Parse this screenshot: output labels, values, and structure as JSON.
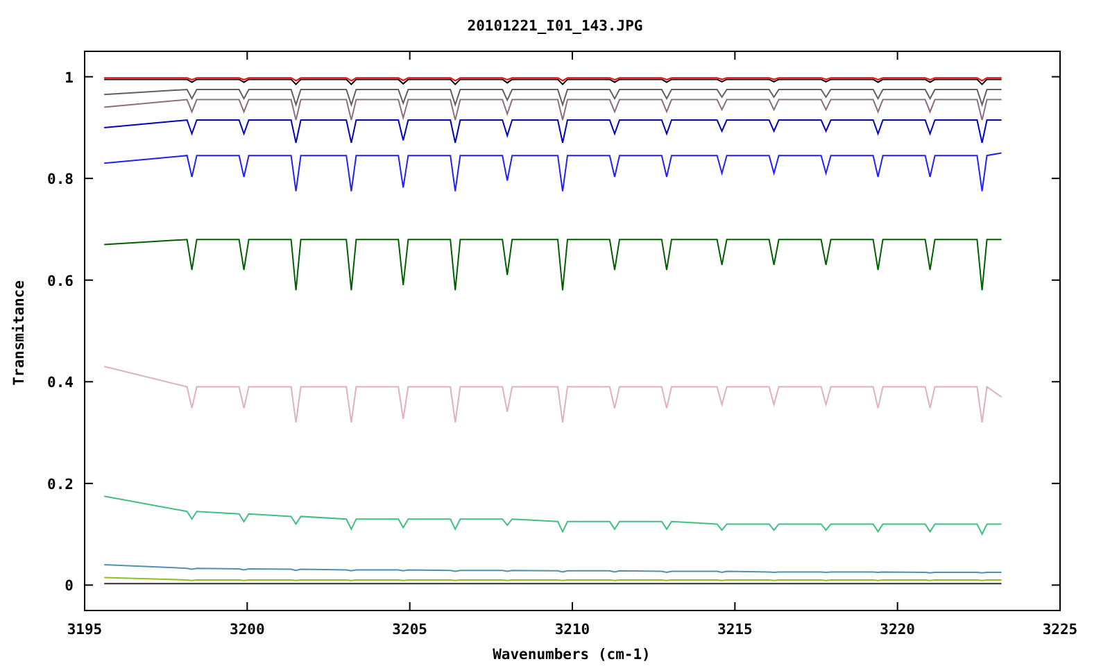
{
  "chart_data": {
    "type": "line",
    "title": "20101221_I01_143.JPG",
    "xlabel": "Wavenumbers (cm-1)",
    "ylabel": "Transmitance",
    "x": [
      3195.6,
      3198.15,
      3198.3,
      3198.45,
      3199.75,
      3199.9,
      3200.05,
      3201.35,
      3201.5,
      3201.65,
      3203.05,
      3203.2,
      3203.35,
      3204.65,
      3204.8,
      3204.95,
      3206.25,
      3206.4,
      3206.55,
      3207.85,
      3208.0,
      3208.15,
      3209.55,
      3209.7,
      3209.85,
      3211.15,
      3211.3,
      3211.45,
      3212.75,
      3212.9,
      3213.05,
      3214.45,
      3214.6,
      3214.75,
      3216.05,
      3216.2,
      3216.35,
      3217.65,
      3217.8,
      3217.95,
      3219.25,
      3219.4,
      3219.55,
      3220.85,
      3221.0,
      3221.15,
      3222.45,
      3222.6,
      3222.75,
      3223.2
    ],
    "xlim": [
      3195,
      3225
    ],
    "ylim": [
      -0.05,
      1.05
    ],
    "xticks": [
      3195,
      3200,
      3205,
      3210,
      3215,
      3220,
      3225
    ],
    "yticks": [
      0,
      0.2,
      0.4,
      0.6,
      0.8,
      1
    ],
    "series": [
      {
        "color": "#000000",
        "values": [
          0.995,
          0.995,
          0.989,
          0.995,
          0.995,
          0.989,
          0.995,
          0.995,
          0.985,
          0.995,
          0.995,
          0.985,
          0.995,
          0.995,
          0.986,
          0.995,
          0.995,
          0.985,
          0.995,
          0.995,
          0.988,
          0.995,
          0.995,
          0.985,
          0.995,
          0.995,
          0.989,
          0.995,
          0.995,
          0.989,
          0.995,
          0.995,
          0.99,
          0.995,
          0.995,
          0.99,
          0.995,
          0.995,
          0.99,
          0.995,
          0.995,
          0.989,
          0.995,
          0.995,
          0.989,
          0.995,
          0.995,
          0.985,
          0.995,
          0.995
        ]
      },
      {
        "color": "#ff0000",
        "values": [
          0.998,
          0.998,
          0.994,
          0.998,
          0.998,
          0.994,
          0.998,
          0.998,
          0.992,
          0.998,
          0.998,
          0.992,
          0.998,
          0.998,
          0.993,
          0.998,
          0.998,
          0.992,
          0.998,
          0.998,
          0.994,
          0.998,
          0.998,
          0.992,
          0.998,
          0.998,
          0.994,
          0.998,
          0.998,
          0.994,
          0.998,
          0.998,
          0.995,
          0.998,
          0.998,
          0.995,
          0.998,
          0.998,
          0.995,
          0.998,
          0.998,
          0.994,
          0.998,
          0.998,
          0.994,
          0.998,
          0.998,
          0.992,
          0.998,
          0.998
        ]
      },
      {
        "color": "#606060",
        "values": [
          0.965,
          0.975,
          0.957,
          0.975,
          0.975,
          0.957,
          0.975,
          0.975,
          0.945,
          0.975,
          0.975,
          0.945,
          0.975,
          0.975,
          0.948,
          0.975,
          0.975,
          0.945,
          0.975,
          0.975,
          0.954,
          0.975,
          0.975,
          0.945,
          0.975,
          0.975,
          0.957,
          0.975,
          0.975,
          0.957,
          0.975,
          0.975,
          0.96,
          0.975,
          0.975,
          0.96,
          0.975,
          0.975,
          0.96,
          0.975,
          0.975,
          0.957,
          0.975,
          0.975,
          0.957,
          0.975,
          0.975,
          0.945,
          0.975,
          0.975
        ]
      },
      {
        "color": "#8a7080",
        "values": [
          0.94,
          0.955,
          0.931,
          0.955,
          0.955,
          0.931,
          0.955,
          0.955,
          0.915,
          0.955,
          0.955,
          0.915,
          0.955,
          0.955,
          0.919,
          0.955,
          0.955,
          0.915,
          0.955,
          0.955,
          0.927,
          0.955,
          0.955,
          0.915,
          0.955,
          0.955,
          0.931,
          0.955,
          0.955,
          0.931,
          0.955,
          0.955,
          0.935,
          0.955,
          0.955,
          0.935,
          0.955,
          0.955,
          0.935,
          0.955,
          0.955,
          0.931,
          0.955,
          0.955,
          0.931,
          0.955,
          0.955,
          0.915,
          0.955,
          0.955
        ]
      },
      {
        "color": "#0000c0",
        "values": [
          0.9,
          0.915,
          0.888,
          0.915,
          0.915,
          0.888,
          0.915,
          0.915,
          0.87,
          0.915,
          0.915,
          0.87,
          0.915,
          0.915,
          0.875,
          0.915,
          0.915,
          0.87,
          0.915,
          0.915,
          0.884,
          0.915,
          0.915,
          0.87,
          0.915,
          0.915,
          0.888,
          0.915,
          0.915,
          0.888,
          0.915,
          0.915,
          0.893,
          0.915,
          0.915,
          0.893,
          0.915,
          0.915,
          0.893,
          0.915,
          0.915,
          0.888,
          0.915,
          0.915,
          0.888,
          0.915,
          0.915,
          0.87,
          0.915,
          0.915
        ]
      },
      {
        "color": "#2020ff",
        "values": [
          0.83,
          0.845,
          0.803,
          0.845,
          0.845,
          0.803,
          0.845,
          0.845,
          0.775,
          0.845,
          0.845,
          0.775,
          0.845,
          0.845,
          0.782,
          0.845,
          0.845,
          0.775,
          0.845,
          0.845,
          0.796,
          0.845,
          0.845,
          0.775,
          0.845,
          0.845,
          0.803,
          0.845,
          0.845,
          0.803,
          0.845,
          0.845,
          0.81,
          0.845,
          0.845,
          0.81,
          0.845,
          0.845,
          0.81,
          0.845,
          0.845,
          0.803,
          0.845,
          0.845,
          0.803,
          0.845,
          0.845,
          0.775,
          0.845,
          0.85
        ]
      },
      {
        "color": "#006000",
        "values": [
          0.67,
          0.68,
          0.62,
          0.68,
          0.68,
          0.62,
          0.68,
          0.68,
          0.58,
          0.68,
          0.68,
          0.58,
          0.68,
          0.68,
          0.59,
          0.68,
          0.68,
          0.58,
          0.68,
          0.68,
          0.61,
          0.68,
          0.68,
          0.58,
          0.68,
          0.68,
          0.62,
          0.68,
          0.68,
          0.62,
          0.68,
          0.68,
          0.63,
          0.68,
          0.68,
          0.63,
          0.68,
          0.68,
          0.63,
          0.68,
          0.68,
          0.62,
          0.68,
          0.68,
          0.62,
          0.68,
          0.68,
          0.58,
          0.68,
          0.68
        ]
      },
      {
        "color": "#e0b0c0",
        "values": [
          0.43,
          0.39,
          0.348,
          0.39,
          0.39,
          0.348,
          0.39,
          0.39,
          0.32,
          0.39,
          0.39,
          0.32,
          0.39,
          0.39,
          0.327,
          0.39,
          0.39,
          0.32,
          0.39,
          0.39,
          0.341,
          0.39,
          0.39,
          0.32,
          0.39,
          0.39,
          0.348,
          0.39,
          0.39,
          0.348,
          0.39,
          0.39,
          0.355,
          0.39,
          0.39,
          0.355,
          0.39,
          0.39,
          0.355,
          0.39,
          0.39,
          0.348,
          0.39,
          0.39,
          0.348,
          0.39,
          0.39,
          0.32,
          0.39,
          0.37
        ]
      },
      {
        "color": "#40c080",
        "values": [
          0.175,
          0.145,
          0.13,
          0.145,
          0.14,
          0.125,
          0.14,
          0.135,
          0.12,
          0.135,
          0.13,
          0.11,
          0.13,
          0.13,
          0.113,
          0.13,
          0.13,
          0.11,
          0.13,
          0.13,
          0.118,
          0.13,
          0.125,
          0.105,
          0.125,
          0.125,
          0.11,
          0.125,
          0.125,
          0.11,
          0.125,
          0.12,
          0.108,
          0.12,
          0.12,
          0.108,
          0.12,
          0.12,
          0.108,
          0.12,
          0.12,
          0.105,
          0.12,
          0.12,
          0.105,
          0.12,
          0.12,
          0.1,
          0.12,
          0.12
        ]
      },
      {
        "color": "#5090b0",
        "values": [
          0.04,
          0.033,
          0.031,
          0.033,
          0.032,
          0.03,
          0.032,
          0.031,
          0.029,
          0.031,
          0.03,
          0.028,
          0.03,
          0.03,
          0.028,
          0.03,
          0.029,
          0.027,
          0.029,
          0.029,
          0.027,
          0.029,
          0.028,
          0.026,
          0.028,
          0.028,
          0.026,
          0.028,
          0.027,
          0.025,
          0.027,
          0.027,
          0.025,
          0.027,
          0.026,
          0.025,
          0.026,
          0.026,
          0.025,
          0.026,
          0.026,
          0.025,
          0.026,
          0.025,
          0.024,
          0.025,
          0.025,
          0.024,
          0.025,
          0.025
        ]
      },
      {
        "color": "#90c020",
        "values": [
          0.015,
          0.01,
          0.009,
          0.01,
          0.01,
          0.009,
          0.01,
          0.01,
          0.009,
          0.01,
          0.01,
          0.009,
          0.01,
          0.01,
          0.009,
          0.01,
          0.01,
          0.009,
          0.01,
          0.01,
          0.009,
          0.01,
          0.01,
          0.009,
          0.01,
          0.01,
          0.009,
          0.01,
          0.01,
          0.009,
          0.01,
          0.01,
          0.009,
          0.01,
          0.01,
          0.009,
          0.01,
          0.01,
          0.009,
          0.01,
          0.01,
          0.009,
          0.01,
          0.01,
          0.009,
          0.01,
          0.01,
          0.009,
          0.01,
          0.01
        ]
      },
      {
        "color": "#303030",
        "values": [
          0.003,
          0.003,
          0.003,
          0.003,
          0.003,
          0.003,
          0.003,
          0.003,
          0.003,
          0.003,
          0.003,
          0.003,
          0.003,
          0.003,
          0.003,
          0.003,
          0.003,
          0.003,
          0.003,
          0.003,
          0.003,
          0.003,
          0.003,
          0.003,
          0.003,
          0.003,
          0.003,
          0.003,
          0.003,
          0.003,
          0.003,
          0.003,
          0.003,
          0.003,
          0.003,
          0.003,
          0.003,
          0.003,
          0.003,
          0.003,
          0.003,
          0.003,
          0.003,
          0.003,
          0.003,
          0.003,
          0.003,
          0.003,
          0.003,
          0.003
        ]
      }
    ]
  }
}
